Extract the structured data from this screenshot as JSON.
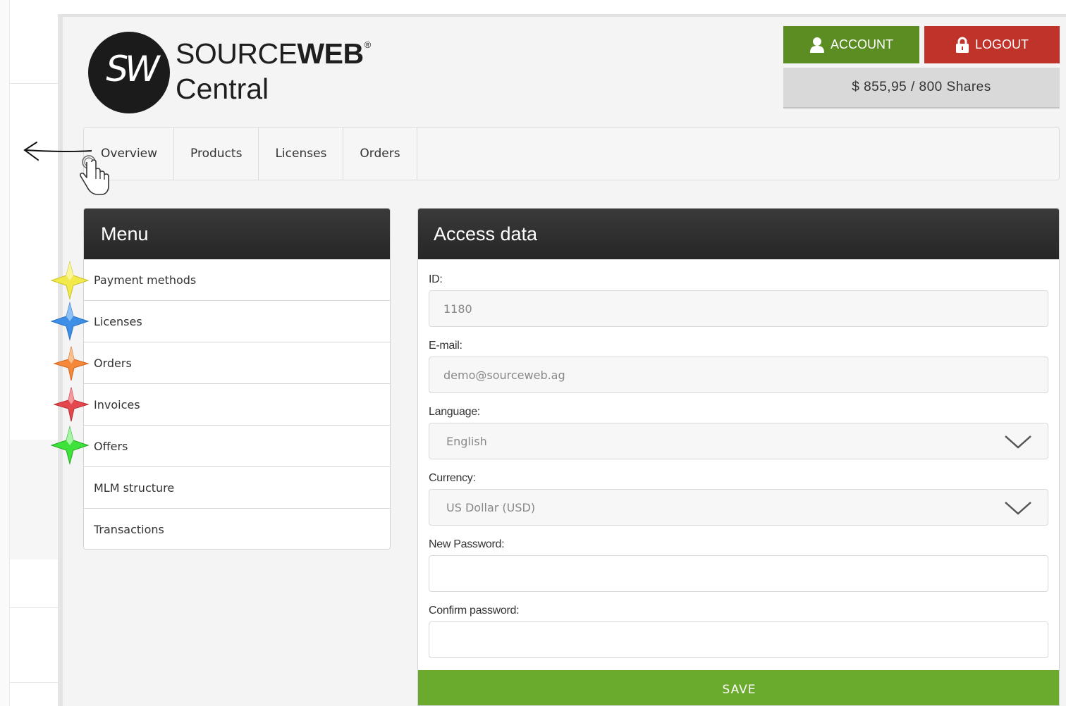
{
  "brand": {
    "mark": "SW",
    "name_regular": "SOURCE",
    "name_bold": "WEB",
    "registered": "®",
    "subtitle": "Central"
  },
  "header": {
    "account_label": "ACCOUNT",
    "logout_label": "LOGOUT",
    "balance": "$ 855,95 / 800 Shares",
    "account_color": "#5b8d23",
    "logout_color": "#c0332b"
  },
  "tabs": [
    {
      "label": "Overview"
    },
    {
      "label": "Products"
    },
    {
      "label": "Licenses"
    },
    {
      "label": "Orders"
    }
  ],
  "menu": {
    "title": "Menu",
    "items": [
      {
        "label": "Payment methods",
        "star": "yellow-star-icon",
        "star_color": "#f2ea4a"
      },
      {
        "label": "Licenses",
        "star": "blue-star-icon",
        "star_color": "#3d8ee6"
      },
      {
        "label": "Orders",
        "star": "orange-star-icon",
        "star_color": "#f5873a"
      },
      {
        "label": "Invoices",
        "star": "red-star-icon",
        "star_color": "#e4474d"
      },
      {
        "label": "Offers",
        "star": "green-star-icon",
        "star_color": "#3ee23a"
      },
      {
        "label": "MLM structure"
      },
      {
        "label": "Transactions"
      }
    ]
  },
  "access": {
    "title": "Access data",
    "id_label": "ID:",
    "id_value": "1180",
    "email_label": "E-mail:",
    "email_value": "demo@sourceweb.ag",
    "language_label": "Language:",
    "language_value": "English",
    "currency_label": "Currency:",
    "currency_value": "US Dollar (USD)",
    "new_password_label": "New Password:",
    "new_password_value": "",
    "confirm_password_label": "Confirm password:",
    "confirm_password_value": "",
    "save_label": "SAVE",
    "save_color": "#6aaa2c"
  },
  "annotations": {
    "arrow": "left-arrow-icon",
    "cursor": "hand-pointer-icon"
  }
}
